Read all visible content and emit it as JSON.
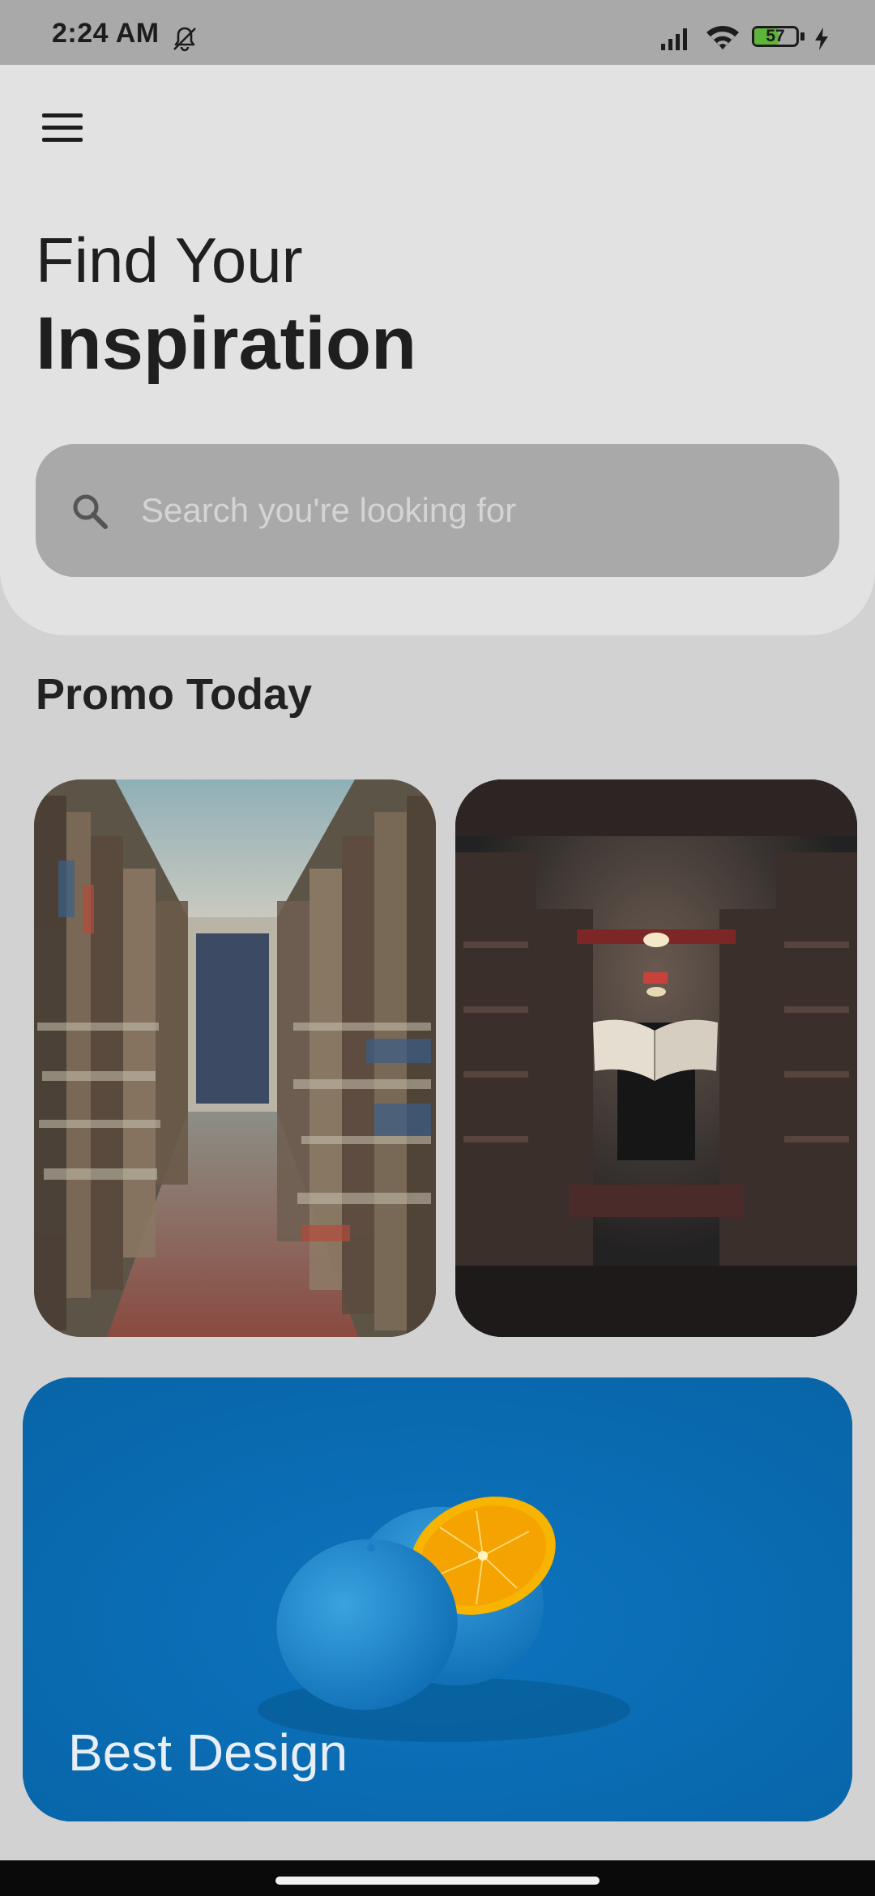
{
  "status_bar": {
    "time": "2:24 AM",
    "battery_level": "57",
    "icons": [
      "mute-icon",
      "signal-icon",
      "wifi-icon",
      "battery-icon",
      "charging-icon"
    ]
  },
  "header": {
    "menu_icon": "hamburger-menu-icon",
    "title_line1": "Find Your",
    "title_line2": "Inspiration"
  },
  "search": {
    "icon": "search-icon",
    "placeholder": "Search you're looking for",
    "value": ""
  },
  "promo": {
    "section_title": "Promo Today",
    "cards": [
      {
        "image": "library-aisle-photo"
      },
      {
        "image": "dark-library-floating-book-photo"
      }
    ]
  },
  "feature": {
    "label": "Best Design",
    "image": "blue-orange-photo"
  },
  "colors": {
    "status_bar_bg": "#a9a9a9",
    "header_bg": "#e2e2e2",
    "page_bg": "#d2d2d2",
    "search_bg": "#a9a9a9",
    "feature_bg": "#0b6db2",
    "battery_fill": "#5fb53a"
  }
}
